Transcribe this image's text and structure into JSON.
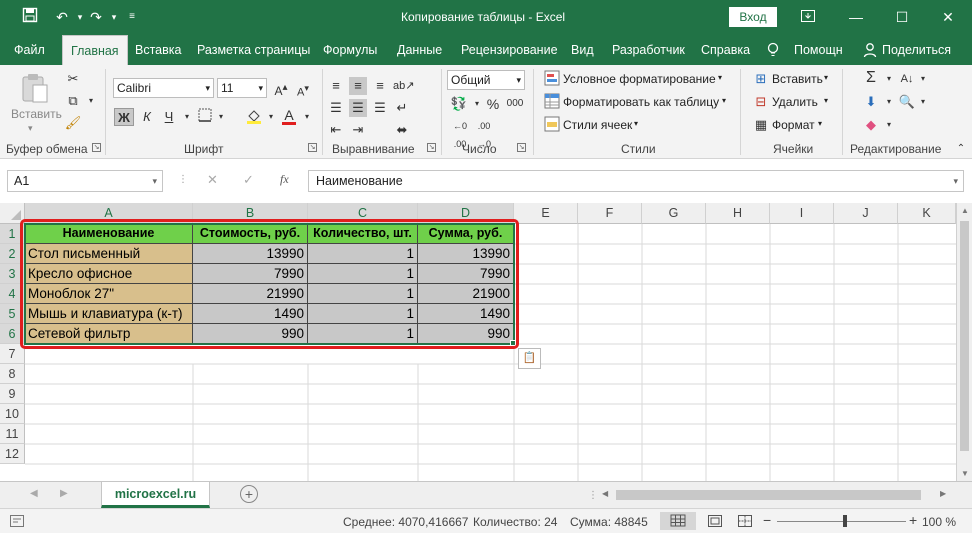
{
  "title_bar": {
    "title": "Копирование таблицы  -  Excel",
    "sign_in": "Вход",
    "save_icon": "save-icon",
    "undo_icon": "undo-icon",
    "redo_icon": "redo-icon",
    "customize_icon": "customize-qat-icon"
  },
  "tabs": [
    {
      "label": "Файл"
    },
    {
      "label": "Главная"
    },
    {
      "label": "Вставка"
    },
    {
      "label": "Разметка страницы"
    },
    {
      "label": "Формулы"
    },
    {
      "label": "Данные"
    },
    {
      "label": "Рецензирование"
    },
    {
      "label": "Вид"
    },
    {
      "label": "Разработчик"
    },
    {
      "label": "Справка"
    },
    {
      "label": "Помощн"
    },
    {
      "label": "Поделиться"
    }
  ],
  "ribbon": {
    "clipboard": {
      "label": "Буфер обмена",
      "paste": "Вставить"
    },
    "font": {
      "label": "Шрифт",
      "font_name": "Calibri",
      "font_size": "11",
      "bold": "Ж",
      "italic": "К",
      "underline": "Ч"
    },
    "alignment": {
      "label": "Выравнивание"
    },
    "number": {
      "label": "Число",
      "format": "Общий",
      "percent": "%",
      "thousands": "000"
    },
    "styles": {
      "label": "Стили",
      "conditional": "Условное форматирование",
      "format_table": "Форматировать как таблицу",
      "cell_styles": "Стили ячеек"
    },
    "cells": {
      "label": "Ячейки",
      "insert": "Вставить",
      "delete": "Удалить",
      "format": "Формат"
    },
    "editing": {
      "label": "Редактирование"
    }
  },
  "formula_bar": {
    "name_box": "A1",
    "fx": "fx",
    "value": "Наименование"
  },
  "columns": [
    "A",
    "B",
    "C",
    "D",
    "E",
    "F",
    "G",
    "H",
    "I",
    "J",
    "K"
  ],
  "rows": [
    "1",
    "2",
    "3",
    "4",
    "5",
    "6",
    "7",
    "8",
    "9",
    "10",
    "11",
    "12"
  ],
  "table": {
    "headers": [
      "Наименование",
      "Стоимость, руб.",
      "Количество, шт.",
      "Сумма, руб."
    ],
    "rows": [
      [
        "Стол письменный",
        "13990",
        "1",
        "13990"
      ],
      [
        "Кресло офисное",
        "7990",
        "1",
        "7990"
      ],
      [
        "Моноблок 27\"",
        "21990",
        "1",
        "21900"
      ],
      [
        "Мышь и клавиатура (к-т)",
        "1490",
        "1",
        "1490"
      ],
      [
        "Сетевой фильтр",
        "990",
        "1",
        "990"
      ]
    ]
  },
  "sheet_tabs": {
    "active": "microexcel.ru",
    "add": "+"
  },
  "status_bar": {
    "average": "Среднее: 4070,416667",
    "count": "Количество: 24",
    "sum": "Сумма: 48845",
    "zoom": "100 %",
    "zoom_minus": "−",
    "zoom_plus": "+"
  },
  "colors": {
    "accent": "#217346",
    "header_fill": "#6fd04a",
    "name_fill": "#d8bf8c",
    "number_fill": "#c8c8c8",
    "highlight": "#e01e1e"
  }
}
